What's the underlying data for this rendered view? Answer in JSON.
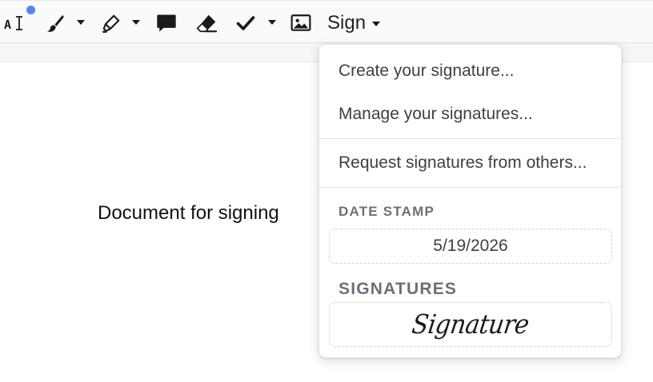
{
  "toolbar": {
    "sign_label": "Sign",
    "tools": [
      {
        "name": "add-text",
        "icon": "text-cursor-icon"
      },
      {
        "name": "draw",
        "icon": "pen-icon"
      },
      {
        "name": "highlight",
        "icon": "highlighter-icon"
      },
      {
        "name": "comment",
        "icon": "speech-bubble-icon"
      },
      {
        "name": "erase",
        "icon": "eraser-icon"
      },
      {
        "name": "check",
        "icon": "checkmark-icon"
      },
      {
        "name": "image",
        "icon": "image-icon"
      }
    ],
    "text_icon_glyph": "A"
  },
  "document": {
    "text": "Document for signing"
  },
  "sign_menu": {
    "create": "Create your signature...",
    "manage": "Manage your signatures...",
    "request": "Request signatures from others...",
    "date_stamp_label": "DATE STAMP",
    "date_value": "5/19/2026",
    "signatures_label": "SIGNATURES",
    "signature_sample": "Signature"
  },
  "colors": {
    "notification_dot": "#5b83e6",
    "menu_text": "#3c4048",
    "section_label": "#6b7078"
  }
}
